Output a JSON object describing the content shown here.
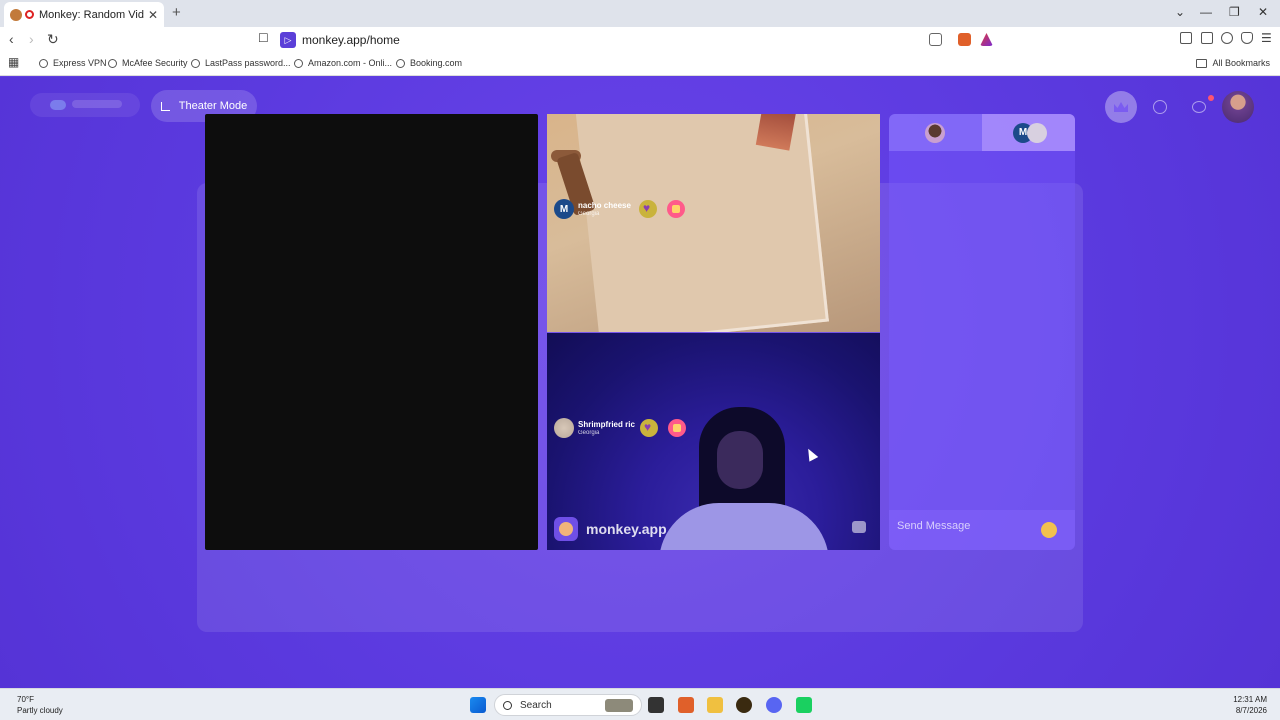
{
  "browser": {
    "tab_title": "Monkey: Random Video Chat",
    "tab_close": "✕",
    "new_tab": "+",
    "url": "monkey.app/home",
    "window_controls": [
      "⌄",
      "—",
      "❐",
      "✕"
    ],
    "bookmarks": [
      "Express VPN",
      "McAfee Security",
      "LastPass password...",
      "Amazon.com - Onli...",
      "Booking.com"
    ],
    "all_bookmarks": "All Bookmarks"
  },
  "page": {
    "theater_mode": "Theater Mode",
    "accent_color": "#5f3ee0",
    "video_top": {
      "user_initial": "M",
      "name": "nacho cheese",
      "location": "Georgia"
    },
    "video_bottom": {
      "name": "Shrimpfried ric",
      "location": "Georgia",
      "watermark": "monkey.app"
    },
    "chat": {
      "tab_initial": "M",
      "send_placeholder": "Send Message"
    }
  },
  "taskbar": {
    "temperature": "70°F",
    "condition": "Partly cloudy",
    "search": "Search",
    "time": "12:31 AM",
    "date": "8/7/2026"
  }
}
